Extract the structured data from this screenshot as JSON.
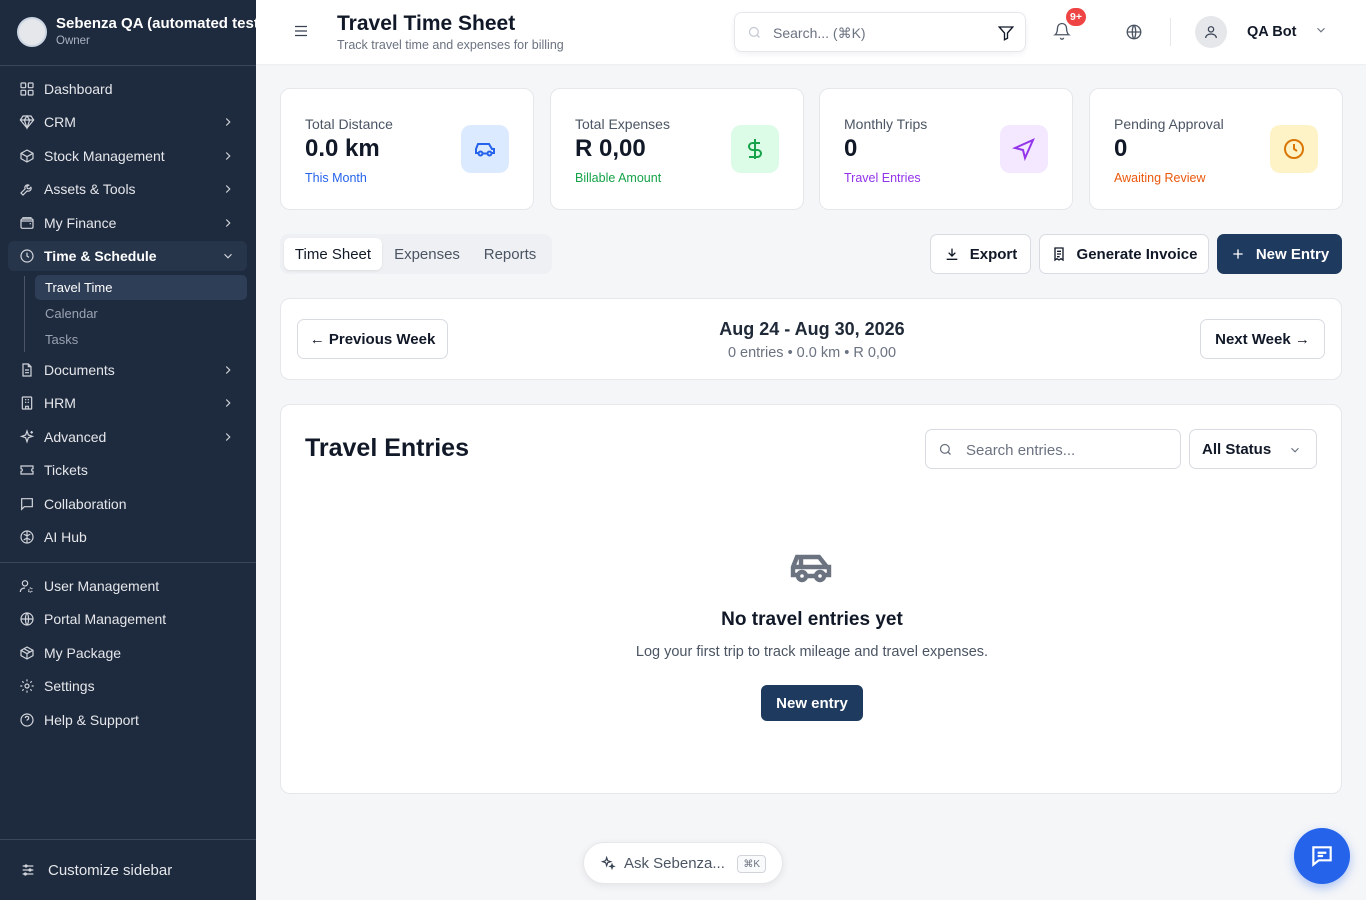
{
  "org": {
    "name": "Sebenza QA (automated tests)",
    "role": "Owner"
  },
  "sidebar": {
    "items": [
      {
        "label": "Dashboard",
        "icon": "grid-icon"
      },
      {
        "label": "CRM",
        "icon": "gem-icon"
      },
      {
        "label": "Stock Management",
        "icon": "box-icon"
      },
      {
        "label": "Assets & Tools",
        "icon": "wrench-icon"
      },
      {
        "label": "My Finance",
        "icon": "wallet-icon"
      },
      {
        "label": "Time & Schedule",
        "icon": "clock-icon"
      },
      {
        "label": "Documents",
        "icon": "document-icon"
      },
      {
        "label": "HRM",
        "icon": "building-icon"
      },
      {
        "label": "Advanced",
        "icon": "sparkle-icon"
      },
      {
        "label": "Tickets",
        "icon": "ticket-icon"
      },
      {
        "label": "Collaboration",
        "icon": "chat-icon"
      },
      {
        "label": "AI Hub",
        "icon": "brain-icon"
      }
    ],
    "time_sub": [
      "Travel Time",
      "Calendar",
      "Tasks"
    ],
    "bottom_items": [
      {
        "label": "User Management",
        "icon": "user-cog-icon"
      },
      {
        "label": "Portal Management",
        "icon": "globe-icon"
      },
      {
        "label": "My Package",
        "icon": "package-icon"
      },
      {
        "label": "Settings",
        "icon": "gear-icon"
      },
      {
        "label": "Help & Support",
        "icon": "help-icon"
      }
    ],
    "customize": "Customize sidebar"
  },
  "header": {
    "title": "Travel Time Sheet",
    "subtitle": "Track travel time and expenses for billing",
    "search_placeholder": "Search... (⌘K)",
    "notif_badge": "9+",
    "user_name": "QA Bot"
  },
  "stats": [
    {
      "label": "Total Distance",
      "value": "0.0 km",
      "note": "This Month",
      "note_color": "#2563eb",
      "icon_bg": "#dbeafe",
      "icon_color": "#2563eb",
      "icon": "car-icon"
    },
    {
      "label": "Total Expenses",
      "value": "R 0,00",
      "note": "Billable Amount",
      "note_color": "#16a34a",
      "icon_bg": "#dcfce7",
      "icon_color": "#16a34a",
      "icon": "dollar-icon"
    },
    {
      "label": "Monthly Trips",
      "value": "0",
      "note": "Travel Entries",
      "note_color": "#9333ea",
      "icon_bg": "#f3e8ff",
      "icon_color": "#9333ea",
      "icon": "navigation-icon"
    },
    {
      "label": "Pending Approval",
      "value": "0",
      "note": "Awaiting Review",
      "note_color": "#ea580c",
      "icon_bg": "#fef3c7",
      "icon_color": "#d97706",
      "icon": "clock-icon"
    }
  ],
  "tabs": [
    "Time Sheet",
    "Expenses",
    "Reports"
  ],
  "actions": {
    "export": "Export",
    "invoice": "Generate Invoice",
    "new_entry": "New Entry"
  },
  "week": {
    "prev": "← Previous Week",
    "next": "Next Week →",
    "range": "Aug 24 - Aug 30, 2026",
    "stats": "0 entries • 0.0 km • R 0,00"
  },
  "entries": {
    "title": "Travel Entries",
    "search_placeholder": "Search entries...",
    "status_filter": "All Status",
    "empty_title": "No travel entries yet",
    "empty_text": "Log your first trip to track mileage and travel expenses.",
    "empty_button": "New entry"
  },
  "ask": {
    "label": "Ask Sebenza...",
    "shortcut": "⌘K"
  },
  "colors": {
    "sidebar_bg": "#1e2a3d",
    "primary": "#1e3a5f",
    "chat": "#2563eb"
  }
}
